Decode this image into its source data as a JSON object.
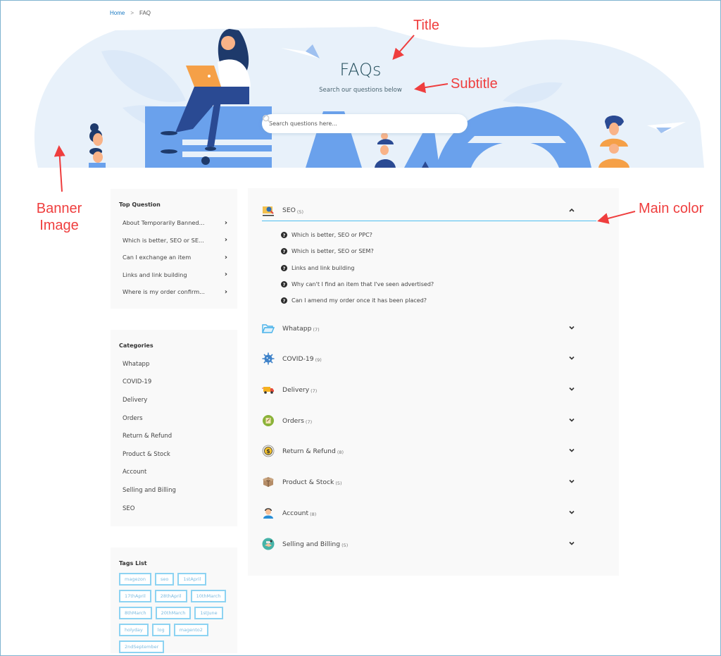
{
  "breadcrumb": {
    "home": "Home",
    "separator": ">",
    "current": "FAQ"
  },
  "banner": {
    "title": "FAQs",
    "subtitle": "Search our questions below",
    "search": {
      "placeholder": "Search questions here...",
      "value": ""
    }
  },
  "sidebar": {
    "top_question": {
      "title": "Top Question",
      "items": [
        {
          "label": "About Temporarily Banned..."
        },
        {
          "label": "Which is better, SEO or SE..."
        },
        {
          "label": "Can I exchange an item"
        },
        {
          "label": "Links and link building"
        },
        {
          "label": "Where is my order confirm..."
        }
      ]
    },
    "categories": {
      "title": "Categories",
      "items": [
        {
          "label": "Whatapp"
        },
        {
          "label": "COVID-19"
        },
        {
          "label": "Delivery"
        },
        {
          "label": "Orders"
        },
        {
          "label": "Return & Refund"
        },
        {
          "label": "Product & Stock"
        },
        {
          "label": "Account"
        },
        {
          "label": "Selling and Billing"
        },
        {
          "label": "SEO"
        }
      ]
    },
    "tags": {
      "title": "Tags List",
      "items": [
        "magezon",
        "seo",
        "1stApril",
        "17thApril",
        "28thApril",
        "10thMarch",
        "8thMarch",
        "20thMarch",
        "1stJune",
        "holyday",
        "log",
        "magento2",
        "2ndSeptember"
      ]
    }
  },
  "faq": {
    "categories": [
      {
        "name": "SEO",
        "count": "(5)",
        "icon": "seo-monitor-icon",
        "expanded": true,
        "questions": [
          "Which is better, SEO or PPC?",
          "Which is better, SEO or SEM?",
          "Links and link building",
          "Why can't I find an item that I've seen advertised?",
          "Can I amend my order once it has been placed?"
        ]
      },
      {
        "name": "Whatapp",
        "count": "(7)",
        "icon": "folder-open-icon",
        "expanded": false
      },
      {
        "name": "COVID-19",
        "count": "(9)",
        "icon": "virus-icon",
        "expanded": false
      },
      {
        "name": "Delivery",
        "count": "(7)",
        "icon": "delivery-truck-icon",
        "expanded": false
      },
      {
        "name": "Orders",
        "count": "(7)",
        "icon": "order-note-icon",
        "expanded": false
      },
      {
        "name": "Return & Refund",
        "count": "(8)",
        "icon": "dollar-coin-icon",
        "expanded": false
      },
      {
        "name": "Product & Stock",
        "count": "(5)",
        "icon": "box-icon",
        "expanded": false
      },
      {
        "name": "Account",
        "count": "(8)",
        "icon": "user-icon",
        "expanded": false
      },
      {
        "name": "Selling and Billing",
        "count": "(5)",
        "icon": "handshake-icon",
        "expanded": false
      }
    ]
  },
  "annotations": {
    "title": "Title",
    "subtitle": "Subtitle",
    "banner_image": "Banner\nImage",
    "main_color": "Main color"
  },
  "colors": {
    "main": "#4ebff0",
    "annotation": "#ef3e3e",
    "banner_bg": "#e8f1fa",
    "banner_blue": "#6aa1ec",
    "title": "#1f4a58"
  }
}
